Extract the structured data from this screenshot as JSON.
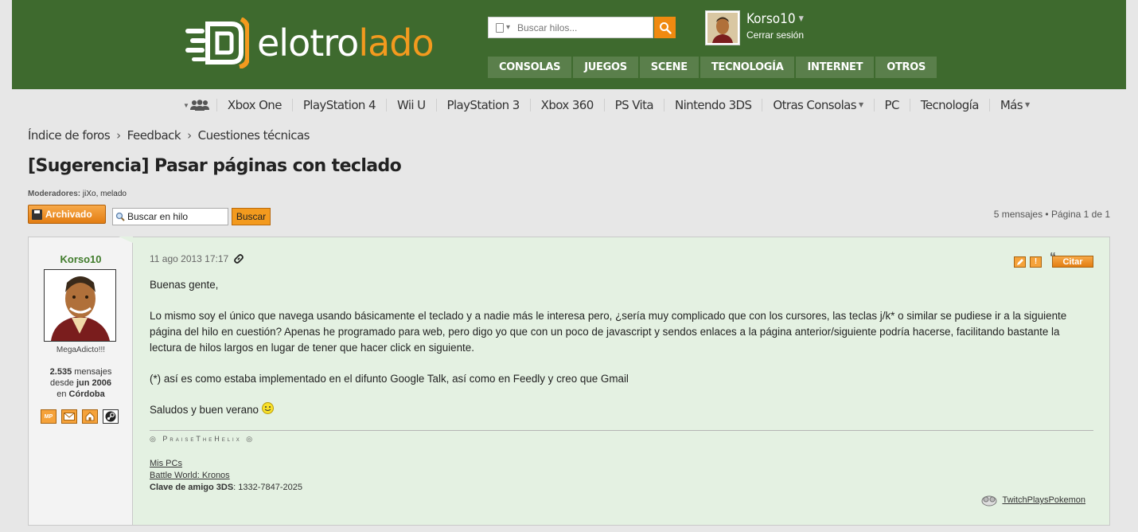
{
  "header": {
    "logo_white": "elotro",
    "logo_orange": "lado",
    "search_placeholder": "Buscar hilos...",
    "user_name": "Korso10",
    "logout_label": "Cerrar sesión",
    "main_nav": [
      "CONSOLAS",
      "JUEGOS",
      "SCENE",
      "TECNOLOGÍA",
      "INTERNET",
      "OTROS"
    ]
  },
  "subnav": {
    "items": [
      "Xbox One",
      "PlayStation 4",
      "Wii U",
      "PlayStation 3",
      "Xbox 360",
      "PS Vita",
      "Nintendo 3DS",
      "Otras Consolas",
      "PC",
      "Tecnología",
      "Más"
    ]
  },
  "breadcrumb": [
    "Índice de foros",
    "Feedback",
    "Cuestiones técnicas"
  ],
  "thread": {
    "title": "[Sugerencia] Pasar páginas con teclado",
    "moderators_label": "Moderadores:",
    "moderators": "jiXo, melado",
    "archived_label": "Archivado",
    "search_value": "Buscar en hilo",
    "search_button": "Buscar",
    "pagination": "5 mensajes • Página 1 de 1"
  },
  "post": {
    "author": "Korso10",
    "rank": "MegaAdicto!!!",
    "messages_count": "2.535",
    "messages_label": "mensajes",
    "since_label": "desde",
    "since": "jun 2006",
    "location_label": "en",
    "location": "Córdoba",
    "date": "11 ago 2013 17:17",
    "quote_label": "Citar",
    "mp_label": "MP",
    "body": [
      "Buenas gente,",
      "Lo mismo soy el único que navega usando básicamente el teclado y a nadie más le interesa pero, ¿sería muy complicado que con los cursores, las teclas j/k* o similar se pudiese ir a la siguiente página del hilo en cuestión? Apenas he programado para web, pero digo yo que con un poco de javascript y sendos enlaces a la página anterior/siguiente podría hacerse, facilitando bastante la lectura de hilos largos en lugar de tener que hacer click en siguiente.",
      "(*) así es como estaba implementado en el difunto Google Talk, así como en Feedly y creo que Gmail",
      "Saludos y buen verano"
    ],
    "signature": {
      "helix": "PraiseTheHelix",
      "link1": "Mis PCs",
      "link2": "Battle World: Kronos",
      "friend_label": "Clave de amigo 3DS",
      "friend_code": "1332-7847-2025",
      "twitch": "TwitchPlaysPokemon"
    }
  }
}
